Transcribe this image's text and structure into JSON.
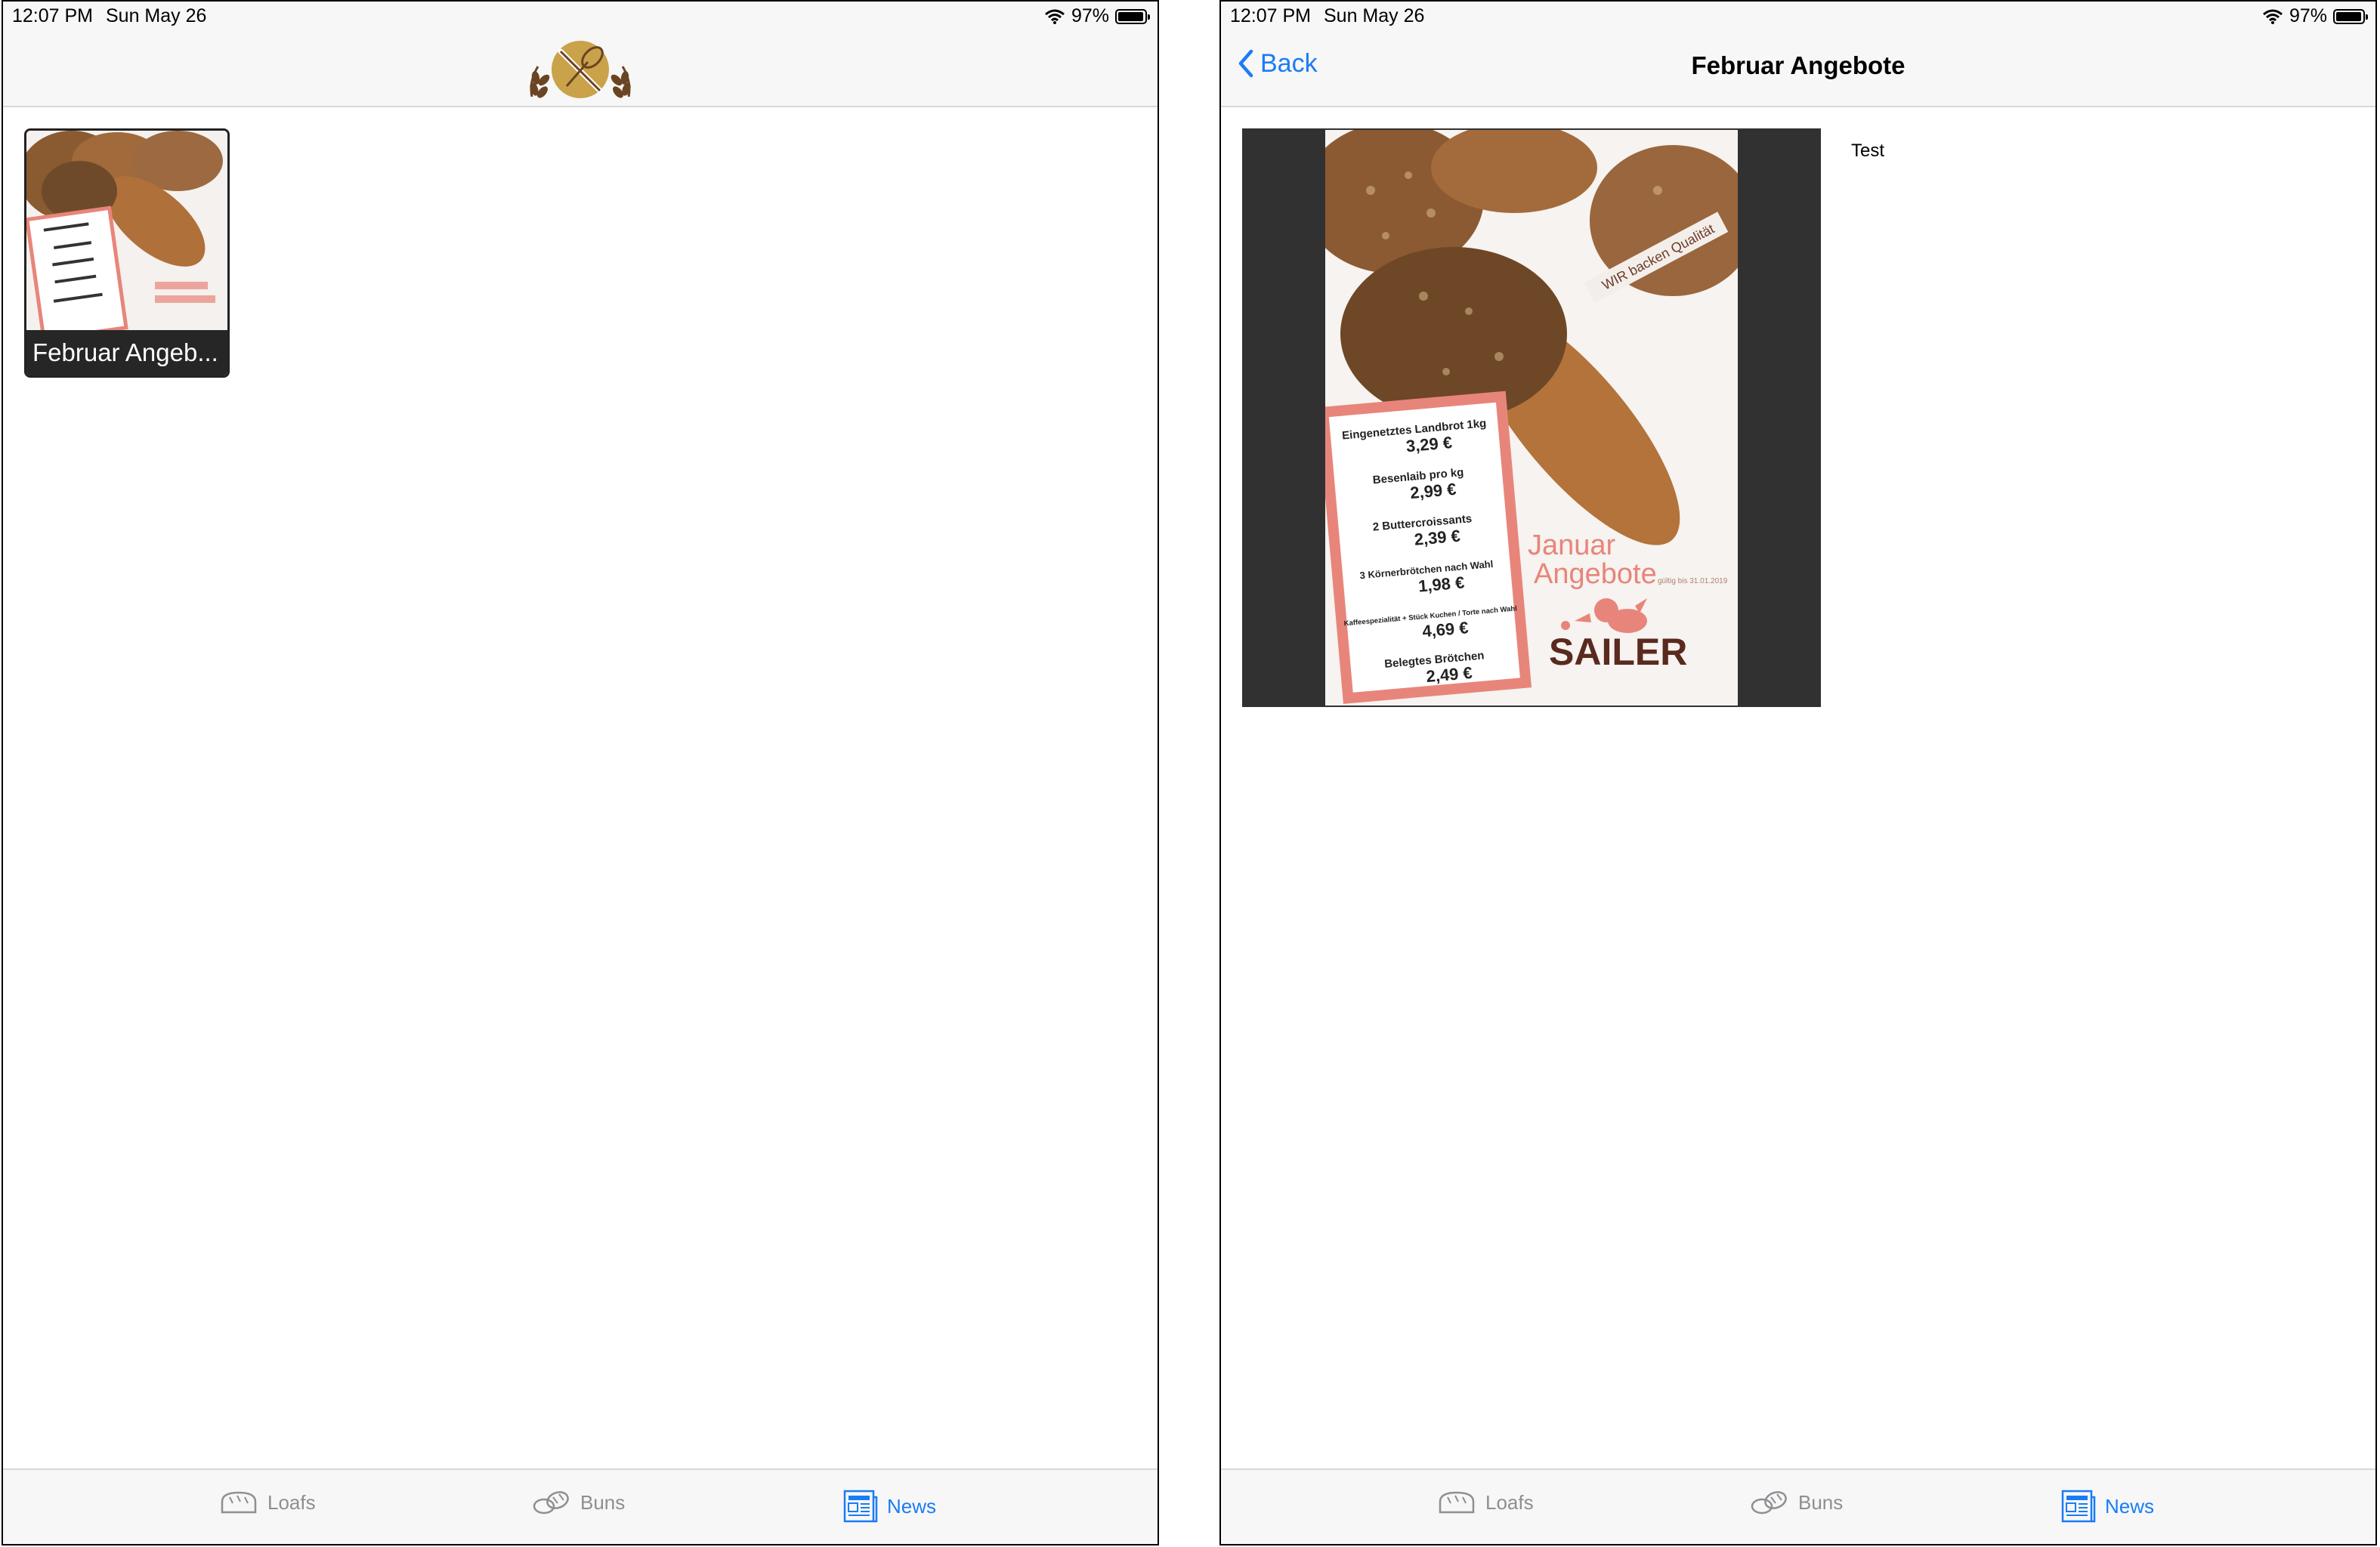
{
  "status": {
    "time": "12:07 PM",
    "date": "Sun May 26",
    "battery": "97%",
    "battery_level": 0.97
  },
  "left_screen": {
    "news_item": {
      "caption": "Februar Angeb..."
    }
  },
  "right_screen": {
    "back_label": "Back",
    "title": "Februar Angebote",
    "description": "Test"
  },
  "poster": {
    "ribbon": "WIR backen Qualität",
    "headline_1": "Januar",
    "headline_2": "Angebote",
    "valid": "gültig bis 31.01.2019",
    "brand": "SAILER",
    "offers": [
      {
        "name": "Eingenetztes Landbrot 1kg",
        "price": "3,29 €"
      },
      {
        "name": "Besenlaib pro kg",
        "price": "2,99 €"
      },
      {
        "name": "2 Buttercroissants",
        "price": "2,39 €"
      },
      {
        "name": "3 Körnerbrötchen nach Wahl",
        "price": "1,98 €"
      },
      {
        "name": "Kaffeespezialität + Stück Kuchen / Torte nach Wahl",
        "price": "4,69 €"
      },
      {
        "name": "Belegtes Brötchen",
        "price": "2,49 €"
      }
    ]
  },
  "tabs": [
    {
      "label": "Loafs",
      "icon": "loaf-icon"
    },
    {
      "label": "Buns",
      "icon": "buns-icon"
    },
    {
      "label": "News",
      "icon": "newspaper-icon",
      "active": true
    }
  ],
  "colors": {
    "accent": "#1a7cf5",
    "inactive": "#8e8e93",
    "logo_gold": "#c9a24a",
    "logo_brown": "#6b4423",
    "poster_pink": "#e8857a",
    "poster_brand": "#5a2a1e"
  }
}
